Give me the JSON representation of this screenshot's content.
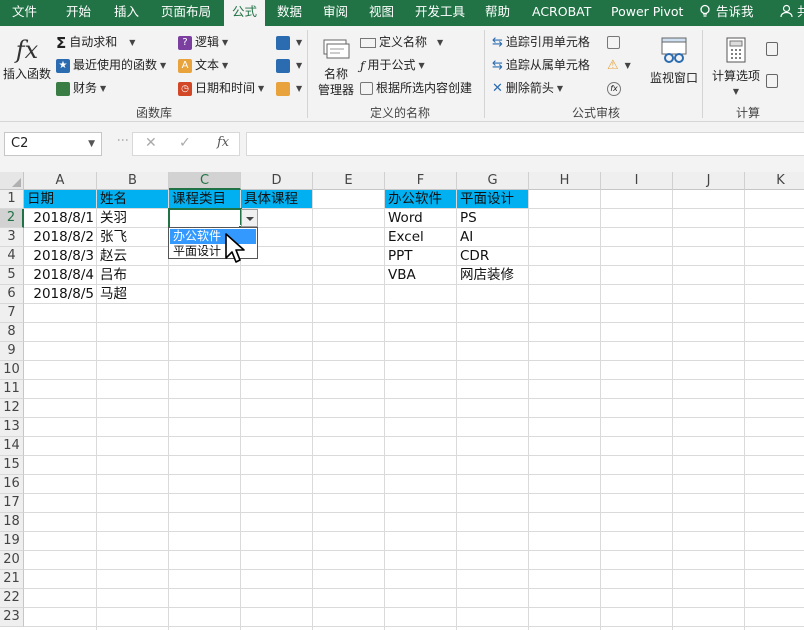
{
  "tabs": [
    {
      "label": "文件",
      "active": false
    },
    {
      "label": "开始",
      "active": false
    },
    {
      "label": "插入",
      "active": false
    },
    {
      "label": "页面布局",
      "active": false
    },
    {
      "label": "公式",
      "active": true
    },
    {
      "label": "数据",
      "active": false
    },
    {
      "label": "审阅",
      "active": false
    },
    {
      "label": "视图",
      "active": false
    },
    {
      "label": "开发工具",
      "active": false
    },
    {
      "label": "帮助",
      "active": false
    },
    {
      "label": "ACROBAT",
      "active": false
    },
    {
      "label": "Power Pivot",
      "active": false
    }
  ],
  "tell_me": "告诉我",
  "share_partial": "共",
  "ribbon": {
    "insert_function": "插入函数",
    "autosum": "自动求和",
    "recent": "最近使用的函数",
    "financial": "财务",
    "logical": "逻辑",
    "text": "文本",
    "datetime": "日期和时间",
    "function_library": "函数库",
    "name_manager": "名称\n管理器",
    "name_manager_l1": "名称",
    "name_manager_l2": "管理器",
    "define_name": "定义名称",
    "use_in_formula": "用于公式",
    "create_from_selection": "根据所选内容创建",
    "defined_names": "定义的名称",
    "trace_precedents": "追踪引用单元格",
    "trace_dependents": "追踪从属单元格",
    "remove_arrows": "删除箭头",
    "formula_auditing": "公式审核",
    "watch_window": "监视窗口",
    "calc_options": "计算选项",
    "calculation": "计算"
  },
  "formula_bar": {
    "name_box": "C2",
    "fx": "fx",
    "cancel": "✕",
    "enter": "✓",
    "content": ""
  },
  "columns": [
    "A",
    "B",
    "C",
    "D",
    "E",
    "F",
    "G",
    "H",
    "I",
    "J",
    "K"
  ],
  "rows": [
    "1",
    "2",
    "3",
    "4",
    "5",
    "6",
    "7",
    "8",
    "9",
    "10",
    "11",
    "12",
    "13",
    "14",
    "15",
    "16",
    "17",
    "18",
    "19",
    "20",
    "21",
    "22",
    "23"
  ],
  "selected_cell": "C2",
  "table1": {
    "headers": [
      "日期",
      "姓名",
      "课程类目",
      "具体课程"
    ],
    "rows": [
      [
        "2018/8/1",
        "关羽"
      ],
      [
        "2018/8/2",
        "张飞"
      ],
      [
        "2018/8/3",
        "赵云"
      ],
      [
        "2018/8/4",
        "吕布"
      ],
      [
        "2018/8/5",
        "马超"
      ]
    ]
  },
  "table2": {
    "headers": [
      "办公软件",
      "平面设计"
    ],
    "rows": [
      [
        "Word",
        "PS"
      ],
      [
        "Excel",
        "AI"
      ],
      [
        "PPT",
        "CDR"
      ],
      [
        "VBA",
        "网店装修"
      ]
    ]
  },
  "dropdown": {
    "options": [
      "办公软件",
      "平面设计"
    ],
    "highlighted": 0
  },
  "colors": {
    "excel_green": "#217346",
    "header_fill": "#00b0f0",
    "dropdown_highlight": "#3399ff"
  }
}
